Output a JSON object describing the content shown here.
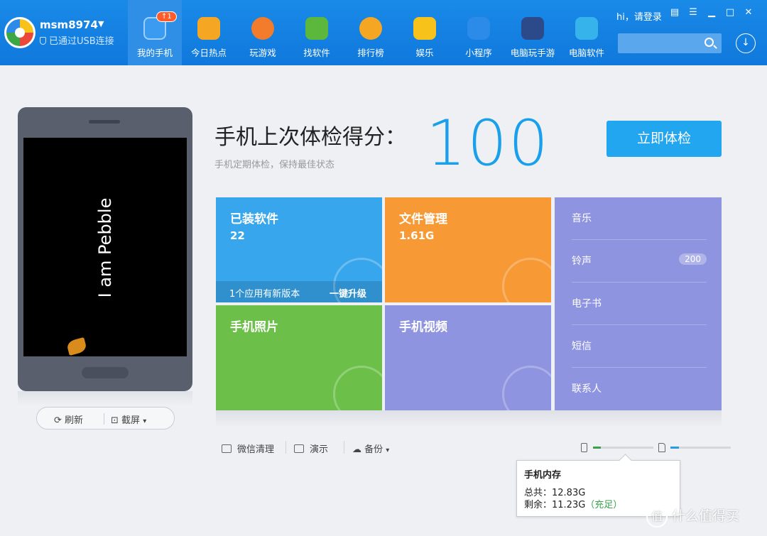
{
  "header": {
    "device_name": "msm8974",
    "device_status": "已通过USB连接",
    "login_text": "hi，请登录",
    "nav": [
      {
        "label": "我的手机",
        "icon": "phone-icon",
        "color": "#3a9bf0",
        "badge": "↑1"
      },
      {
        "label": "今日热点",
        "icon": "star-icon",
        "color": "#f5a623"
      },
      {
        "label": "玩游戏",
        "icon": "gamepad-icon",
        "color": "#f37b2c"
      },
      {
        "label": "找软件",
        "icon": "android-icon",
        "color": "#5cb83c"
      },
      {
        "label": "排行榜",
        "icon": "medal-icon",
        "color": "#f5a623"
      },
      {
        "label": "娱乐",
        "icon": "folder-icon",
        "color": "#f7c21a"
      },
      {
        "label": "小程序",
        "icon": "miniapp-icon",
        "color": "#2c8ae8"
      },
      {
        "label": "电脑玩手游",
        "icon": "monitor-game-icon",
        "color": "#2c4a8a"
      },
      {
        "label": "电脑软件",
        "icon": "windows-icon",
        "color": "#35b3ea"
      }
    ]
  },
  "phone_preview": {
    "screen_text": "I am Pebble",
    "refresh_label": "刷新",
    "capture_label": "截屏",
    "capture_caret": "▾"
  },
  "checkup": {
    "title": "手机上次体检得分：",
    "subtitle": "手机定期体检，保持最佳状态",
    "score": "100",
    "button_label": "立即体检"
  },
  "tiles": {
    "apps": {
      "title": "已装软件",
      "value": "22",
      "update_text": "1个应用有新版本",
      "upgrade_label": "一键升级"
    },
    "files": {
      "title": "文件管理",
      "value": "1.61G"
    },
    "photos": {
      "title": "手机照片"
    },
    "videos": {
      "title": "手机视频"
    }
  },
  "media_list": [
    {
      "label": "音乐"
    },
    {
      "label": "铃声",
      "badge": "200"
    },
    {
      "label": "电子书"
    },
    {
      "label": "短信"
    },
    {
      "label": "联系人"
    }
  ],
  "toolbar": {
    "wechat_clean": "微信清理",
    "demo": "演示",
    "backup": "备份",
    "backup_caret": "▾"
  },
  "storage": {
    "phone_fraction": 0.13,
    "sd_fraction": 0.14,
    "tooltip_title": "手机内存",
    "total_text": "总共：12.83G",
    "free_text": "剩余：11.23G",
    "free_status": "（充足）"
  },
  "watermark": {
    "text": "什么值得买",
    "glyph": "值"
  }
}
